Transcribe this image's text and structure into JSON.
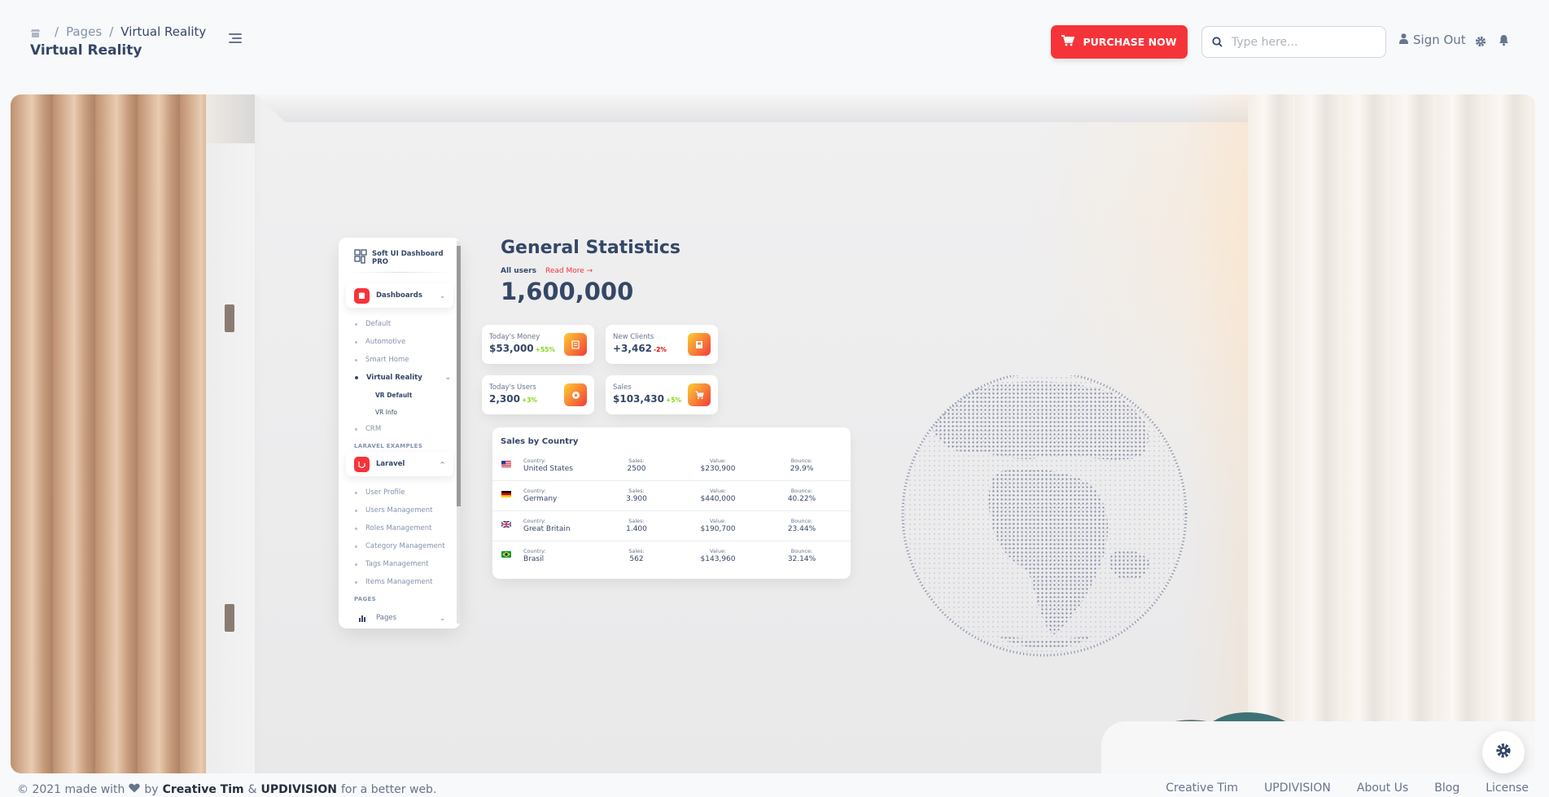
{
  "breadcrumb": {
    "items": [
      "Pages",
      "Virtual Reality"
    ],
    "separator": "/"
  },
  "page_title": "Virtual Reality",
  "navbar": {
    "purchase_label": "PURCHASE NOW",
    "search_placeholder": "Type here...",
    "signout_label": "Sign Out"
  },
  "vr_sidebar": {
    "brand": "Soft UI Dashboard PRO",
    "dashboards_label": "Dashboards",
    "dashboards_items": [
      "Default",
      "Automotive",
      "Smart Home",
      "Virtual Reality",
      "CRM"
    ],
    "vr_subitems": [
      "VR Default",
      "VR Info"
    ],
    "laravel_heading": "LARAVEL EXAMPLES",
    "laravel_label": "Laravel",
    "laravel_items": [
      "User Profile",
      "Users Management",
      "Roles Management",
      "Category Management",
      "Tags Management",
      "Items Management"
    ],
    "pages_heading": "PAGES",
    "pages_label": "Pages"
  },
  "stats": {
    "title": "General Statistics",
    "all_users_label": "All users",
    "read_more": "Read More",
    "total": "1,600,000",
    "cards": [
      {
        "label": "Today's Money",
        "value": "$53,000",
        "change": "+55%",
        "positive": true
      },
      {
        "label": "New Clients",
        "value": "+3,462",
        "change": "-2%",
        "positive": false
      },
      {
        "label": "Today's Users",
        "value": "2,300",
        "change": "+3%",
        "positive": true
      },
      {
        "label": "Sales",
        "value": "$103,430",
        "change": "+5%",
        "positive": true
      }
    ]
  },
  "sales_by_country": {
    "title": "Sales by Country",
    "headers": {
      "country": "Country:",
      "sales": "Sales:",
      "value": "Value:",
      "bounce": "Bounce:"
    },
    "rows": [
      {
        "country": "United States",
        "sales": "2500",
        "value": "$230,900",
        "bounce": "29.9%"
      },
      {
        "country": "Germany",
        "sales": "3.900",
        "value": "$440,000",
        "bounce": "40.22%"
      },
      {
        "country": "Great Britain",
        "sales": "1.400",
        "value": "$190,700",
        "bounce": "23.44%"
      },
      {
        "country": "Brasil",
        "sales": "562",
        "value": "$143,960",
        "bounce": "32.14%"
      }
    ]
  },
  "footer": {
    "prefix": "© 2021 made with",
    "by": "by",
    "author1": "Creative Tim",
    "amp": "&",
    "author2": "UPDIVISION",
    "suffix": "for a better web.",
    "links": [
      "Creative Tim",
      "UPDIVISION",
      "About Us",
      "Blog",
      "License"
    ]
  },
  "colors": {
    "accent": "#f5343a",
    "text": "#344767",
    "muted": "#67748e",
    "positive": "#82d616",
    "negative": "#ea0606"
  }
}
